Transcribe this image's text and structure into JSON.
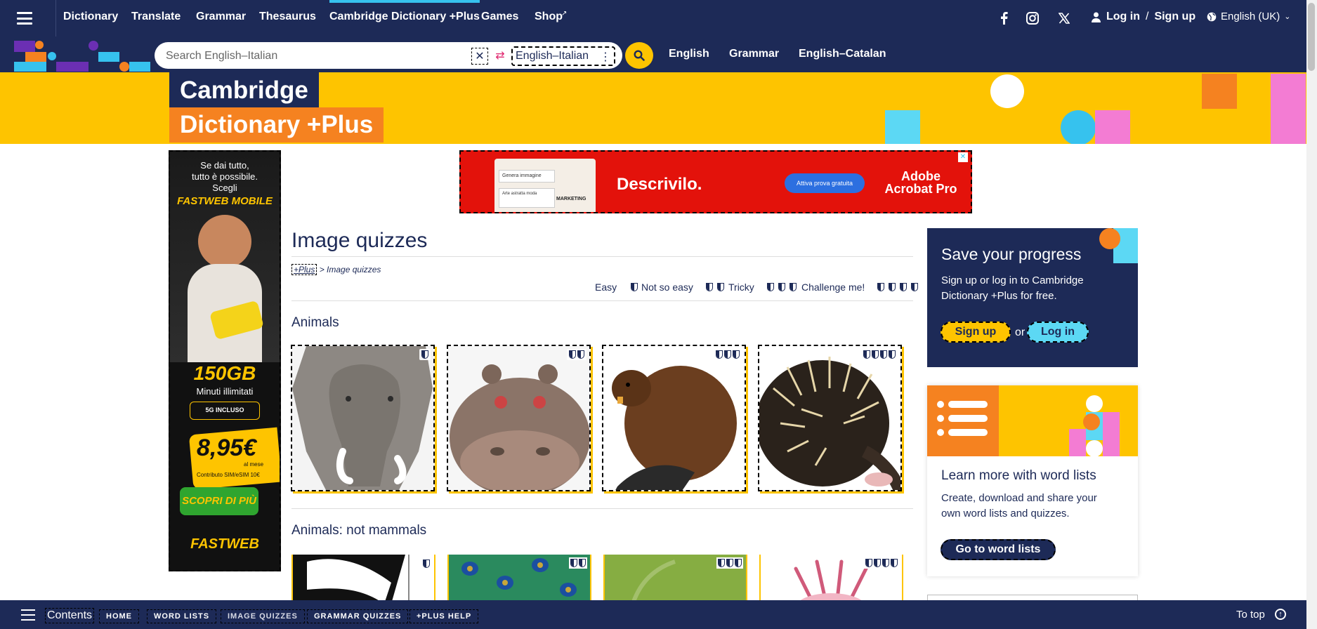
{
  "nav": {
    "links": [
      "Dictionary",
      "Translate",
      "Grammar",
      "Thesaurus",
      "Cambridge Dictionary +Plus",
      "Games",
      "Shop"
    ],
    "login": "Log in",
    "slash": "/",
    "signup": "Sign up",
    "language": "English (UK)"
  },
  "search": {
    "placeholder": "Search English–Italian",
    "dictionary": "English–Italian",
    "quick_links": [
      "English",
      "Grammar",
      "English–Catalan"
    ]
  },
  "banner": {
    "line1": "Cambridge",
    "line2": "Dictionary +Plus"
  },
  "ads": {
    "left": {
      "line1": "Se dai tutto,",
      "line2": "tutto è possibile.",
      "line3": "Scegli",
      "brand": "FASTWEB MOBILE",
      "gb": "150GB",
      "minutes": "Minuti illimitati",
      "fiveg": "5G INCLUSO",
      "price": "8,95€",
      "per": "al mese",
      "contrib": "Contributo SIM/eSIM 10€",
      "cta": "SCOPRI DI PIÙ",
      "logo": "FASTWEB"
    },
    "top": {
      "headline": "Descrivilo.",
      "cta": "Attiva prova gratuita",
      "brand1": "Adobe",
      "brand2": "Acrobat Pro",
      "mock1": "Genera immagine",
      "mock2": "Arte astratta moda",
      "mock3": "MARKETING"
    }
  },
  "page": {
    "title": "Image quizzes",
    "crumb_link": "+Plus",
    "crumb_rest": " > Image quizzes",
    "levels": [
      {
        "label": "Easy",
        "n": 1
      },
      {
        "label": "Not so easy",
        "n": 2
      },
      {
        "label": "Tricky",
        "n": 3
      },
      {
        "label": "Challenge me!",
        "n": 4
      }
    ],
    "sections": [
      {
        "title": "Animals",
        "cards": [
          {
            "name": "elephant",
            "level": 1
          },
          {
            "name": "hippo",
            "level": 2
          },
          {
            "name": "beaver",
            "level": 3
          },
          {
            "name": "echidna",
            "level": 4
          }
        ]
      },
      {
        "title": "Animals: not mammals",
        "cards": [
          {
            "name": "butterfly",
            "level": 1
          },
          {
            "name": "peacock",
            "level": 2
          },
          {
            "name": "insect",
            "level": 3
          },
          {
            "name": "axolotl",
            "level": 4
          }
        ]
      }
    ]
  },
  "save_panel": {
    "title": "Save your progress",
    "text": "Sign up or log in to Cambridge Dictionary +Plus for free.",
    "signup": "Sign up",
    "or": "or",
    "login": "Log in"
  },
  "wordlists": {
    "title": "Learn more with word lists",
    "text": "Create, download and share your own word lists and quizzes.",
    "button": "Go to word lists"
  },
  "bottom": {
    "contents": "Contents",
    "links": [
      "HOME",
      "WORD LISTS",
      "IMAGE QUIZZES",
      "GRAMMAR QUIZZES",
      "+PLUS HELP"
    ],
    "totop": "To top"
  },
  "colors": {
    "navy": "#1d2a57",
    "yellow": "#fec400",
    "orange": "#f58220",
    "cyan": "#36c2ee",
    "pink": "#f37cd3"
  }
}
